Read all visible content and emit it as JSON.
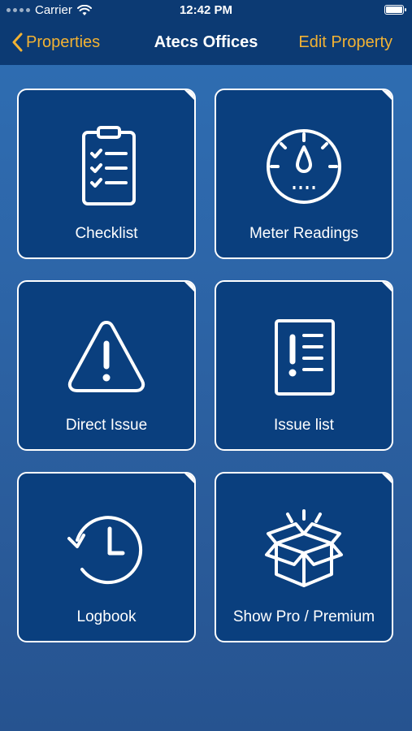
{
  "status_bar": {
    "carrier": "Carrier",
    "time": "12:42 PM"
  },
  "nav": {
    "back_label": "Properties",
    "title": "Atecs Offices",
    "edit_label": "Edit Property"
  },
  "tiles": [
    {
      "label": "Checklist",
      "icon": "clipboard-checklist-icon"
    },
    {
      "label": "Meter Readings",
      "icon": "gauge-icon"
    },
    {
      "label": "Direct Issue",
      "icon": "warning-triangle-icon"
    },
    {
      "label": "Issue list",
      "icon": "issue-list-icon"
    },
    {
      "label": "Logbook",
      "icon": "history-clock-icon"
    },
    {
      "label": "Show Pro / Premium",
      "icon": "open-box-icon"
    }
  ],
  "colors": {
    "accent": "#f2b233",
    "navbar": "#0c3a73",
    "tile": "#0a3f7e"
  }
}
